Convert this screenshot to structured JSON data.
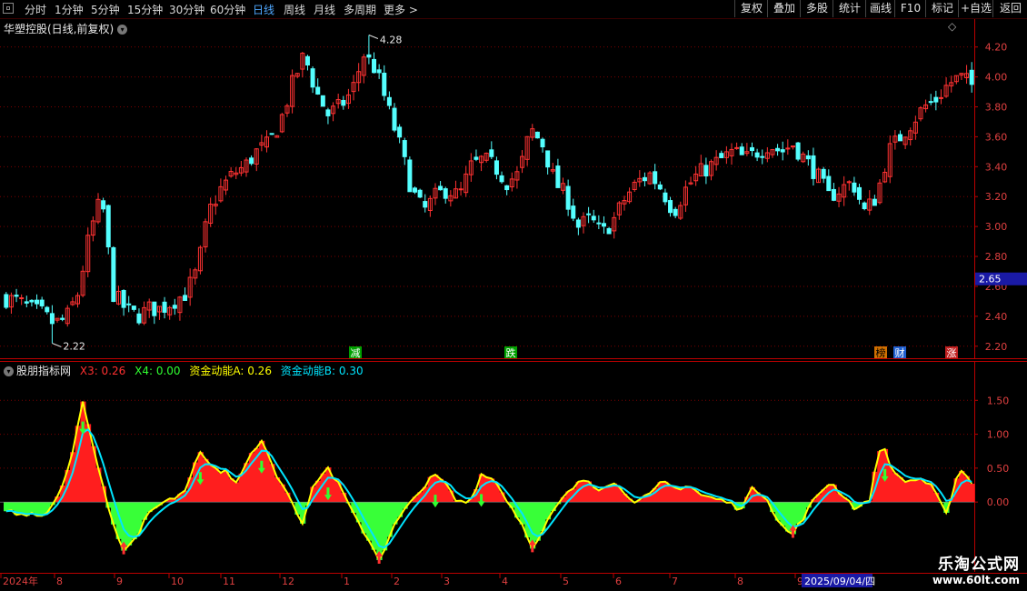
{
  "toolbar": {
    "periods": [
      "分时",
      "1分钟",
      "5分钟",
      "15分钟",
      "30分钟",
      "60分钟",
      "日线",
      "周线",
      "月线",
      "多周期",
      "更多 >"
    ],
    "active_period": "日线",
    "right_buttons": [
      "复权",
      "叠加",
      "多股",
      "统计",
      "画线",
      "F10",
      "标记",
      "+自选",
      "返回"
    ]
  },
  "price_pane": {
    "title": "华塑控股(日线,前复权)",
    "high_label": "4.28",
    "low_label": "2.22",
    "current_price": "2.65",
    "axis_ticks": [
      "4.20",
      "4.00",
      "3.80",
      "3.60",
      "3.40",
      "3.20",
      "3.00",
      "2.80",
      "2.60",
      "2.40",
      "2.20"
    ],
    "event_markers": [
      "减",
      "跌",
      "榜",
      "财",
      "涨"
    ]
  },
  "indicator_pane": {
    "title": "股朋指标网",
    "legend": [
      {
        "label": "X3: 0.26",
        "color": "#ff3030"
      },
      {
        "label": "X4: 0.00",
        "color": "#30ff30"
      },
      {
        "label": "资金动能A: 0.26",
        "color": "#ffff00"
      },
      {
        "label": "资金动能B: 0.30",
        "color": "#00e5ff"
      }
    ],
    "axis_ticks": [
      "1.50",
      "1.00",
      "0.50",
      "0.00"
    ]
  },
  "time_axis": {
    "labels": [
      "2024年",
      "8",
      "9",
      "10",
      "11",
      "12",
      "1",
      "2",
      "3",
      "4",
      "5",
      "6",
      "7",
      "8",
      "9"
    ],
    "cursor_date": "2025/09/04/四"
  },
  "watermark": {
    "line1": "乐淘公式网",
    "line2": "www.60lt.com"
  },
  "colors": {
    "up": "#ff3232",
    "down": "#54ffff",
    "grid": "#7a0000",
    "active": "#4fa8ff"
  },
  "chart_data": [
    {
      "type": "candlestick",
      "title": "华塑控股(日线,前复权)",
      "ylim": [
        2.15,
        4.35
      ],
      "marked_high": 4.28,
      "marked_low": 2.22,
      "close_path": [
        2.52,
        2.5,
        2.45,
        2.42,
        2.35,
        2.38,
        2.55,
        2.95,
        3.2,
        2.55,
        2.45,
        2.4,
        2.45,
        2.45,
        2.5,
        2.55,
        2.7,
        3.1,
        3.25,
        3.35,
        3.4,
        3.5,
        3.55,
        3.7,
        3.95,
        4.15,
        3.9,
        3.75,
        3.8,
        3.9,
        4.15,
        4.05,
        3.8,
        3.55,
        3.25,
        3.1,
        3.2,
        3.25,
        3.2,
        3.4,
        3.45,
        3.4,
        3.3,
        3.35,
        3.65,
        3.55,
        3.3,
        3.2,
        3.0,
        3.05,
        2.95,
        3.05,
        3.2,
        3.3,
        3.35,
        3.25,
        3.1,
        3.25,
        3.35,
        3.4,
        3.45,
        3.5,
        3.45,
        3.5,
        3.55,
        3.5,
        3.55,
        3.45,
        3.35,
        3.2,
        3.25,
        3.3,
        3.1,
        3.2,
        3.5,
        3.6,
        3.7,
        3.8,
        3.85,
        3.95,
        4.0,
        3.95
      ],
      "last_close": 3.95
    },
    {
      "type": "area",
      "title": "股朋指标网",
      "ylim": [
        -0.95,
        2.0
      ],
      "X3": 0.26,
      "X4": 0.0,
      "资金动能A": 0.26,
      "资金动能B": 0.3,
      "osc_path": [
        -0.1,
        -0.2,
        -0.15,
        -0.2,
        0.1,
        0.6,
        1.5,
        0.6,
        -0.1,
        -0.7,
        -0.55,
        -0.2,
        0.0,
        0.05,
        0.2,
        0.8,
        0.5,
        0.45,
        0.3,
        0.7,
        0.9,
        0.4,
        0.1,
        -0.3,
        0.3,
        0.5,
        0.2,
        -0.2,
        -0.5,
        -0.85,
        -0.4,
        -0.1,
        0.1,
        0.4,
        0.3,
        0.0,
        0.0,
        0.45,
        0.3,
        0.0,
        -0.3,
        -0.7,
        -0.3,
        0.0,
        0.2,
        0.35,
        0.2,
        0.3,
        0.15,
        0.0,
        0.1,
        0.3,
        0.2,
        0.25,
        0.1,
        0.05,
        0.0,
        -0.1,
        0.2,
        0.1,
        -0.3,
        -0.5,
        -0.2,
        0.1,
        0.3,
        0.1,
        -0.1,
        0.0,
        0.9,
        0.4,
        0.3,
        0.35,
        0.2,
        -0.2,
        0.5,
        0.3
      ]
    }
  ]
}
